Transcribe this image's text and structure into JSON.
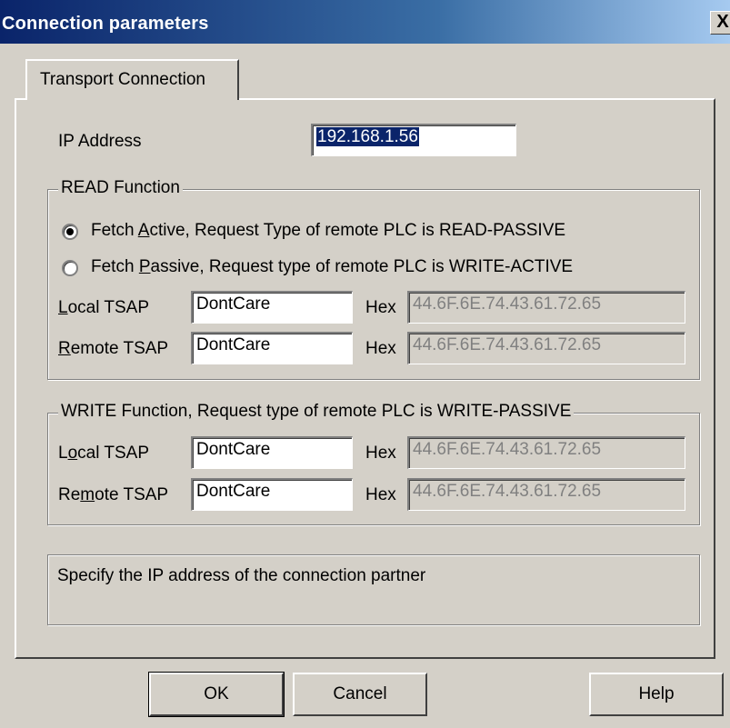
{
  "window": {
    "title": "Connection parameters",
    "close_glyph": "X"
  },
  "tab": {
    "label": "Transport Connection"
  },
  "ip": {
    "label": "IP Address",
    "value": "192.168.1.56"
  },
  "read": {
    "legend": "READ Function",
    "option_active": {
      "pre": "Fetch ",
      "key": "A",
      "post": "ctive,   Request Type of remote PLC is READ-PASSIVE",
      "selected": true
    },
    "option_passive": {
      "pre": "Fetch ",
      "key": "P",
      "post": "assive, Request type of remote PLC is WRITE-ACTIVE",
      "selected": false
    },
    "local_tsap": {
      "key": "L",
      "label": "ocal TSAP",
      "value": "DontCare",
      "hex_label": "Hex",
      "hex_value": "44.6F.6E.74.43.61.72.65"
    },
    "remote_tsap": {
      "key": "R",
      "label": "emote TSAP",
      "value": "DontCare",
      "hex_label": "Hex",
      "hex_value": "44.6F.6E.74.43.61.72.65"
    }
  },
  "write": {
    "legend": "WRITE Function, Request type of remote PLC is WRITE-PASSIVE",
    "local_tsap": {
      "pre": "L",
      "key": "o",
      "post": "cal TSAP",
      "value": "DontCare",
      "hex_label": "Hex",
      "hex_value": "44.6F.6E.74.43.61.72.65"
    },
    "remote_tsap": {
      "pre": "Re",
      "key": "m",
      "post": "ote TSAP",
      "value": "DontCare",
      "hex_label": "Hex",
      "hex_value": "44.6F.6E.74.43.61.72.65"
    }
  },
  "info": {
    "text": "Specify the IP address of the connection partner"
  },
  "buttons": {
    "ok": "OK",
    "cancel": "Cancel",
    "help": "Help"
  },
  "colors": {
    "titlebar_start": "#0a246a",
    "titlebar_end": "#a6caf0",
    "face": "#d4d0c8",
    "selection": "#0a246a"
  }
}
